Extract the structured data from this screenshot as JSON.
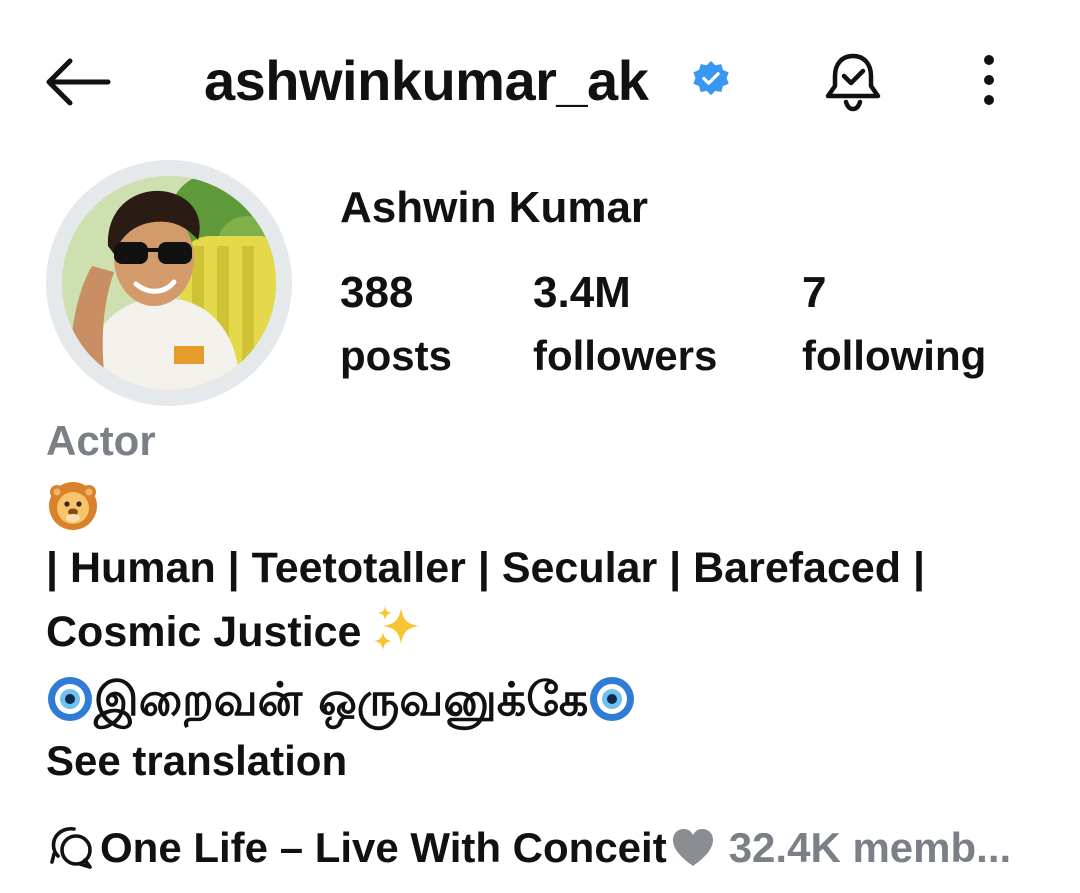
{
  "header": {
    "username": "ashwinkumar_ak",
    "back_icon": "arrow-left-icon",
    "verified_icon": "verified-badge-icon",
    "verified_color": "#3897f0",
    "bell_icon": "bell-check-icon",
    "more_icon": "more-vertical-icon"
  },
  "profile": {
    "display_name": "Ashwin Kumar",
    "avatar_icon": "avatar-photo"
  },
  "stats": {
    "posts": {
      "count": "388",
      "label": "posts"
    },
    "followers": {
      "count": "3.4M",
      "label": "followers"
    },
    "following": {
      "count": "7",
      "label": "following"
    }
  },
  "bio": {
    "category": "Actor",
    "category_color": "#7b8088",
    "line1": " | Human | Teetotaller | Secular | Barefaced |",
    "line2": "Cosmic Justice",
    "line3": "இறைவன் ஒருவனுக்கே",
    "see_translation": "See translation"
  },
  "channel": {
    "name": "One Life – Live With Conceit",
    "members": "32.4K memb...",
    "icon": "broadcast-chat-icon"
  }
}
